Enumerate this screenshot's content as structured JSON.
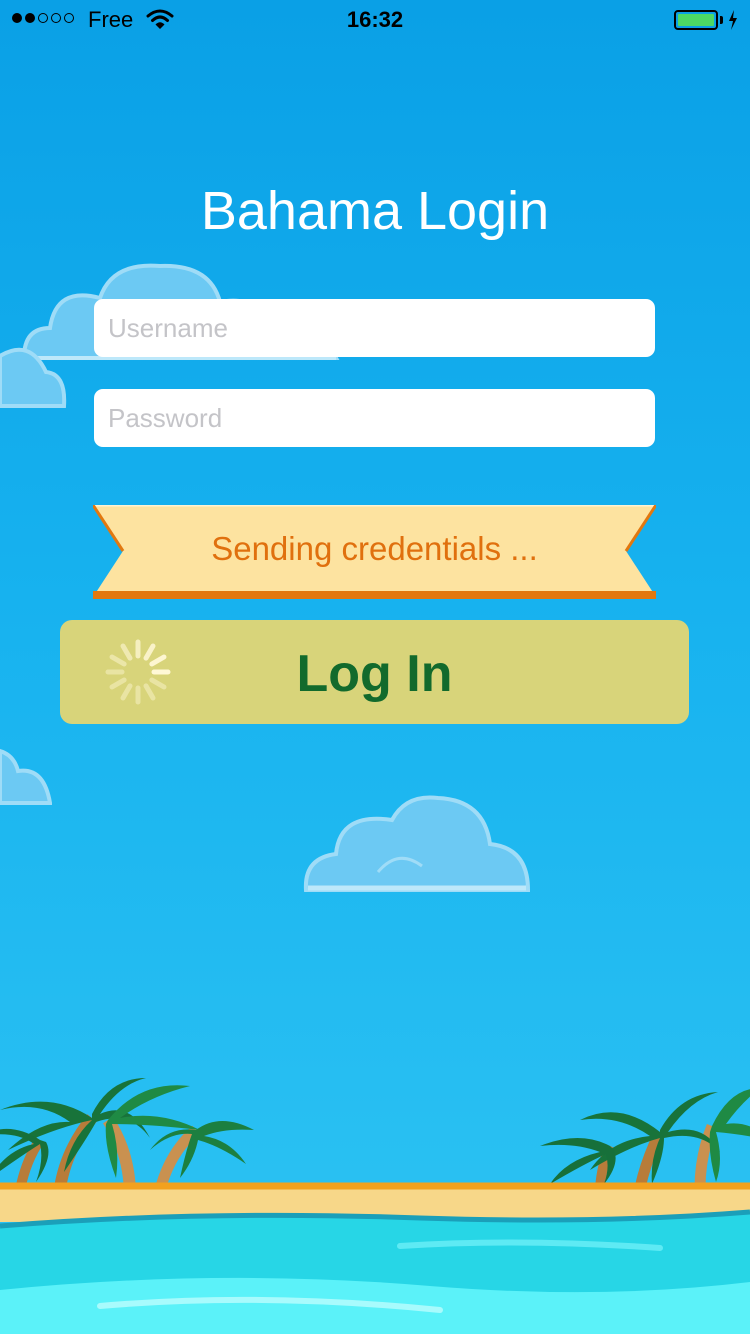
{
  "status_bar": {
    "carrier": "Free",
    "time": "16:32",
    "signal_bars_filled": 2,
    "signal_bars_total": 5,
    "battery_level": 1.0,
    "charging": true
  },
  "login": {
    "title": "Bahama Login",
    "username_placeholder": "Username",
    "username_value": "",
    "password_placeholder": "Password",
    "password_value": "",
    "status_message": "Sending credentials ...",
    "login_button_label": "Log In",
    "loading": true
  },
  "colors": {
    "sky_top": "#0aa0e6",
    "sky_bottom": "#2ec4f3",
    "ribbon_fill": "#fde3a0",
    "ribbon_edge": "#e2780f",
    "status_text": "#e0700e",
    "button_fill": "#d8d47a",
    "button_text": "#126a2c",
    "battery": "#4cd964"
  },
  "icons": [
    "wifi-icon",
    "charging-icon",
    "spinner-icon",
    "cloud-icon",
    "palm-tree-icon"
  ]
}
